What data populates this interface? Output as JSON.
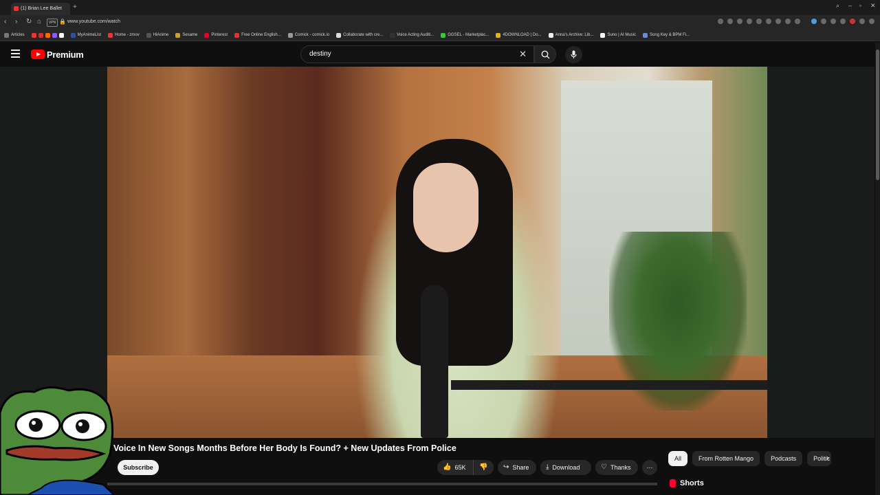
{
  "browser": {
    "tab_title": "(1) Brian Lee Ballet",
    "url": "www.youtube.com/watch",
    "vpn_label": "VPN",
    "bookmarks": [
      "Articles",
      "MyAnimeList",
      "Home - zmov",
      "HiAnime",
      "Sesame",
      "Pinterest",
      "Free Online English...",
      "Comick - comick.io",
      "Collaborate with cre...",
      "Voice Acting Auditi...",
      "GGSEL - Marketplac...",
      "4DOWNLOAD | Do...",
      "Anna's Archive: Lib...",
      "Suno | AI Music",
      "Song Key & BPM Fi..."
    ]
  },
  "header": {
    "logo_text": "Premium",
    "search_value": "destiny"
  },
  "video": {
    "title": "Voice In New Songs Months Before Her Body Is Found? + New Updates From Police",
    "subscribe_label": "Subscribe",
    "likes": "65K",
    "share_label": "Share",
    "download_label": "Download",
    "thanks_label": "Thanks",
    "more_label": "⋯"
  },
  "sidebar": {
    "chips": [
      "All",
      "From Rotten Mango",
      "Podcasts",
      "Politic"
    ],
    "shorts_label": "Shorts"
  },
  "colors": {
    "brand": "#ff0000",
    "background": "#0f0f0f",
    "pill": "#272727"
  }
}
